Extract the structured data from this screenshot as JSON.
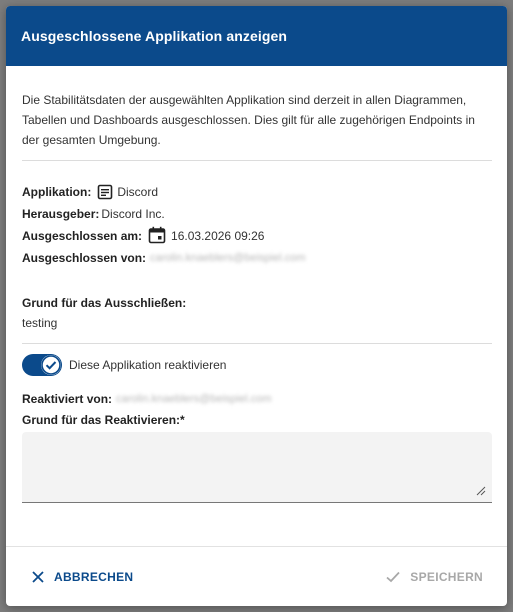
{
  "dialog": {
    "title": "Ausgeschlossene Applikation anzeigen",
    "intro": "Die Stabilitätsdaten der ausgewählten Applikation sind derzeit in allen Diagrammen, Tabellen und Dashboards ausgeschlossen. Dies gilt für alle zugehörigen Endpoints in der gesamten Umgebung."
  },
  "info": {
    "application_label": "Applikation:",
    "application_value": "Discord",
    "application_icon": "document-icon",
    "publisher_label": "Herausgeber:",
    "publisher_value": "Discord Inc.",
    "excluded_on_label": "Ausgeschlossen am:",
    "excluded_on_value": "16.03.2026 09:26",
    "excluded_on_icon": "calendar-icon",
    "excluded_by_label": "Ausgeschlossen von:",
    "excluded_by_value": "carolin.knaeblers@beispiel.com"
  },
  "reason": {
    "label": "Grund für das Ausschließen:",
    "value": "testing"
  },
  "reactivate": {
    "toggle_label": "Diese Applikation reaktivieren",
    "toggle_on": true,
    "reactivated_by_label": "Reaktiviert von:",
    "reactivated_by_value": "carolin.knaeblers@beispiel.com",
    "reason_label": "Grund für das Reaktivieren:*",
    "reason_value": ""
  },
  "footer": {
    "cancel_label": "ABBRECHEN",
    "save_label": "SPEICHERN"
  },
  "colors": {
    "accent": "#0b4a8b",
    "disabled": "#a8a8a8"
  }
}
